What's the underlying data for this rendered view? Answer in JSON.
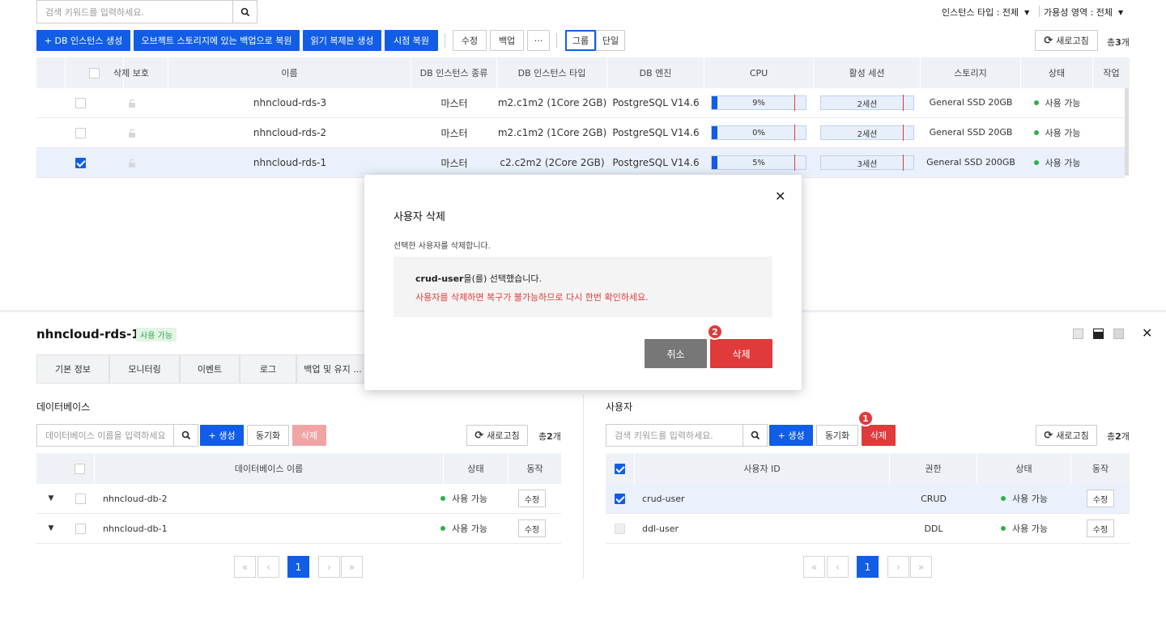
{
  "top": {
    "search_placeholder": "검색 키워드를 입력하세요.",
    "filter_instance_type": "인스턴스 타입 : 전체",
    "filter_az": "가용성 영역 : 전체",
    "buttons": {
      "create": "+ DB 인스턴스 생성",
      "restore_backup": "오브젝트 스토리지에 있는 백업으로 복원",
      "create_replica": "읽기 복제본 생성",
      "pitr": "시점 복원",
      "modify": "수정",
      "backup": "백업",
      "more": "···",
      "group": "그룹",
      "single": "단일",
      "refresh": "새로고침"
    },
    "total_prefix": "총",
    "total_count": "3",
    "total_suffix": "개",
    "columns": [
      "삭제 보호",
      "이름",
      "DB 인스턴스 종류",
      "DB 인스턴스 타입",
      "DB 엔진",
      "CPU",
      "활성 세션",
      "스토리지",
      "상태",
      "작업"
    ],
    "rows": [
      {
        "name": "nhncloud-rds-3",
        "kind": "마스터",
        "type": "m2.c1m2 (1Core 2GB)",
        "engine": "PostgreSQL V14.6",
        "cpu": "9%",
        "cpu_pct": 9,
        "session": "2세션",
        "storage": "General SSD 20GB",
        "status": "사용 가능",
        "selected": false
      },
      {
        "name": "nhncloud-rds-2",
        "kind": "마스터",
        "type": "m2.c1m2 (1Core 2GB)",
        "engine": "PostgreSQL V14.6",
        "cpu": "0%",
        "cpu_pct": 0,
        "session": "2세션",
        "storage": "General SSD 20GB",
        "status": "사용 가능",
        "selected": false
      },
      {
        "name": "nhncloud-rds-1",
        "kind": "마스터",
        "type": "c2.c2m2 (2Core 2GB)",
        "engine": "PostgreSQL V14.6",
        "cpu": "5%",
        "cpu_pct": 5,
        "session": "3세션",
        "storage": "General SSD 200GB",
        "status": "사용 가능",
        "selected": true
      }
    ]
  },
  "detail": {
    "title": "nhncloud-rds-1",
    "badge": "사용 가능",
    "tabs": [
      "기본 정보",
      "모니터링",
      "이벤트",
      "로그",
      "백업 및 유지 ..."
    ]
  },
  "db_panel": {
    "title": "데이터베이스",
    "search_placeholder": "데이터베이스 이름을 입력하세요",
    "create": "+ 생성",
    "sync": "동기화",
    "delete": "삭제",
    "refresh": "새로고침",
    "total_prefix": "총",
    "total_count": "2",
    "total_suffix": "개",
    "columns": [
      "데이터베이스 이름",
      "상태",
      "동작"
    ],
    "rows": [
      {
        "name": "nhncloud-db-2",
        "status": "사용 가능",
        "action": "수정"
      },
      {
        "name": "nhncloud-db-1",
        "status": "사용 가능",
        "action": "수정"
      }
    ],
    "page": "1"
  },
  "user_panel": {
    "title": "사용자",
    "search_placeholder": "검색 키워드를 입력하세요.",
    "create": "+ 생성",
    "sync": "동기화",
    "delete": "삭제",
    "refresh": "새로고침",
    "total_prefix": "총",
    "total_count": "2",
    "total_suffix": "개",
    "columns": [
      "사용자 ID",
      "권한",
      "상태",
      "동작"
    ],
    "rows": [
      {
        "id": "crud-user",
        "perm": "CRUD",
        "status": "사용 가능",
        "action": "수정",
        "selected": true
      },
      {
        "id": "ddl-user",
        "perm": "DDL",
        "status": "사용 가능",
        "action": "수정",
        "selected": false
      }
    ],
    "page": "1"
  },
  "modal": {
    "title": "사용자 삭제",
    "desc": "선택한 사용자를 삭제합니다.",
    "selected_user": "crud-user",
    "selected_suffix": "을(를) 선택했습니다.",
    "warning": "사용자를 삭제하면 복구가 불가능하므로 다시 한번 확인하세요.",
    "cancel": "취소",
    "confirm": "삭제"
  },
  "markers": [
    "1",
    "2"
  ],
  "colors": {
    "primary": "#125de6",
    "danger": "#e03a3a",
    "ok": "#2bb14a"
  }
}
